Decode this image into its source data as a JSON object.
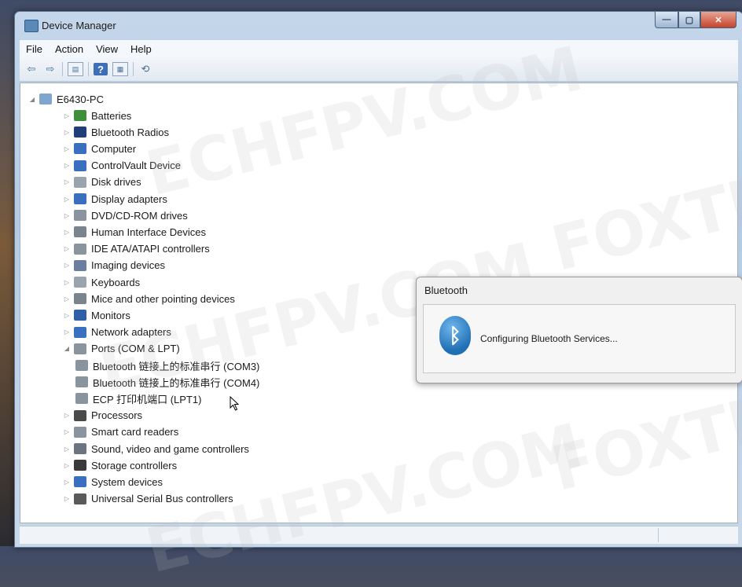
{
  "window": {
    "title": "Device Manager"
  },
  "menu": [
    "File",
    "Action",
    "View",
    "Help"
  ],
  "toolbar": {
    "icons": [
      "back-arrow-icon",
      "forward-arrow-icon",
      "properties-icon",
      "help-icon",
      "show-hidden-icon",
      "scan-hardware-icon"
    ]
  },
  "tree": {
    "root": "E6430-PC",
    "categories": [
      {
        "label": "Batteries",
        "expanded": false,
        "icon": "battery-icon",
        "color": "#3f8f3a"
      },
      {
        "label": "Bluetooth Radios",
        "expanded": false,
        "icon": "bluetooth-icon",
        "color": "#1f3f78"
      },
      {
        "label": "Computer",
        "expanded": false,
        "icon": "computer-icon",
        "color": "#3a6fc0"
      },
      {
        "label": "ControlVault Device",
        "expanded": false,
        "icon": "security-device-icon",
        "color": "#3a6fc0"
      },
      {
        "label": "Disk drives",
        "expanded": false,
        "icon": "disk-drive-icon",
        "color": "#9aa4ae"
      },
      {
        "label": "Display adapters",
        "expanded": false,
        "icon": "display-adapter-icon",
        "color": "#3a6fc0"
      },
      {
        "label": "DVD/CD-ROM drives",
        "expanded": false,
        "icon": "dvd-drive-icon",
        "color": "#8a949e"
      },
      {
        "label": "Human Interface Devices",
        "expanded": false,
        "icon": "hid-icon",
        "color": "#7a848e"
      },
      {
        "label": "IDE ATA/ATAPI controllers",
        "expanded": false,
        "icon": "ide-controller-icon",
        "color": "#8a949e"
      },
      {
        "label": "Imaging devices",
        "expanded": false,
        "icon": "imaging-device-icon",
        "color": "#6b7ea0"
      },
      {
        "label": "Keyboards",
        "expanded": false,
        "icon": "keyboard-icon",
        "color": "#9aa4ae"
      },
      {
        "label": "Mice and other pointing devices",
        "expanded": false,
        "icon": "mouse-icon",
        "color": "#7a848e"
      },
      {
        "label": "Monitors",
        "expanded": false,
        "icon": "monitor-icon",
        "color": "#2f5fa8"
      },
      {
        "label": "Network adapters",
        "expanded": false,
        "icon": "network-adapter-icon",
        "color": "#3a6fc0"
      },
      {
        "label": "Ports (COM & LPT)",
        "expanded": true,
        "icon": "port-icon",
        "color": "#8a949e"
      },
      {
        "label": "Bluetooth 链接上的标准串行 (COM3)",
        "child": true,
        "icon": "port-icon",
        "color": "#8a949e"
      },
      {
        "label": "Bluetooth 链接上的标准串行 (COM4)",
        "child": true,
        "icon": "port-icon",
        "color": "#8a949e"
      },
      {
        "label": "ECP 打印机端口 (LPT1)",
        "child": true,
        "icon": "port-icon",
        "color": "#8a949e"
      },
      {
        "label": "Processors",
        "expanded": false,
        "icon": "processor-icon",
        "color": "#4a4a4a"
      },
      {
        "label": "Smart card readers",
        "expanded": false,
        "icon": "smart-card-reader-icon",
        "color": "#8a949e"
      },
      {
        "label": "Sound, video and game controllers",
        "expanded": false,
        "icon": "sound-icon",
        "color": "#6b7480"
      },
      {
        "label": "Storage controllers",
        "expanded": false,
        "icon": "storage-controller-icon",
        "color": "#3a3a3a"
      },
      {
        "label": "System devices",
        "expanded": false,
        "icon": "system-device-icon",
        "color": "#3a6fc0"
      },
      {
        "label": "Universal Serial Bus controllers",
        "expanded": false,
        "icon": "usb-icon",
        "color": "#5a5a5a"
      }
    ]
  },
  "dialog": {
    "title": "Bluetooth",
    "message": "Configuring Bluetooth Services...",
    "icon": "bluetooth-logo-icon"
  },
  "watermarks": [
    "ECHFPV.COM",
    "FOXTE",
    "ECHFPV.COM",
    "FOXTE",
    "ECHFPV.COM"
  ],
  "colors": {
    "window_chrome": "#b6cbe3",
    "accent": "#1f6fb4",
    "close_button": "#c4442c"
  }
}
